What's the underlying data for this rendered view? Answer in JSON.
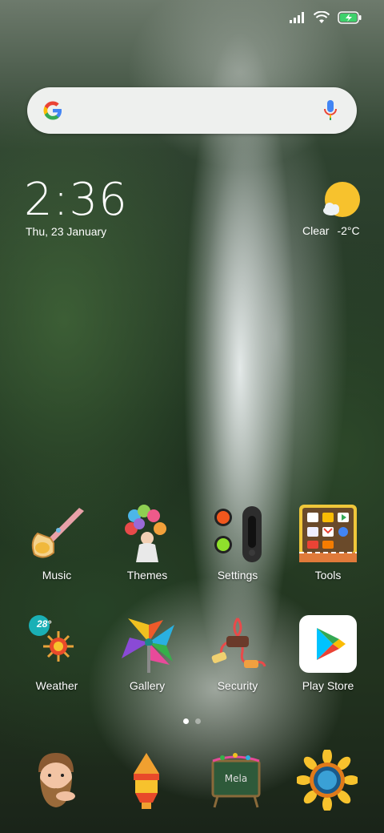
{
  "statusbar": {
    "icons": [
      "signal-icon",
      "wifi-icon",
      "battery-charging-icon"
    ]
  },
  "search": {
    "icons": [
      "google-logo-icon",
      "microphone-icon"
    ]
  },
  "clock": {
    "time": "2:36",
    "date": "Thu, 23 January"
  },
  "weather": {
    "condition": "Clear",
    "temperature": "-2°C",
    "icon": "partly-sunny-icon"
  },
  "apps_row1": [
    {
      "label": "Music",
      "icon": "vuvuzela-icon"
    },
    {
      "label": "Themes",
      "icon": "balloons-icon"
    },
    {
      "label": "Settings",
      "icon": "traffic-lights-icon"
    },
    {
      "label": "Tools",
      "icon": "tools-folder-icon"
    }
  ],
  "apps_row2": [
    {
      "label": "Weather",
      "icon": "weather-sun-icon",
      "badge": "28°"
    },
    {
      "label": "Gallery",
      "icon": "pinwheel-icon"
    },
    {
      "label": "Security",
      "icon": "jump-rope-icon"
    },
    {
      "label": "Play Store",
      "icon": "play-store-icon"
    }
  ],
  "dock": [
    {
      "icon": "bearded-man-icon"
    },
    {
      "icon": "lantern-icon"
    },
    {
      "icon": "chalkboard-icon",
      "text": "Mela"
    },
    {
      "icon": "sunflower-icon"
    }
  ],
  "pages": {
    "count": 2,
    "current": 1
  }
}
